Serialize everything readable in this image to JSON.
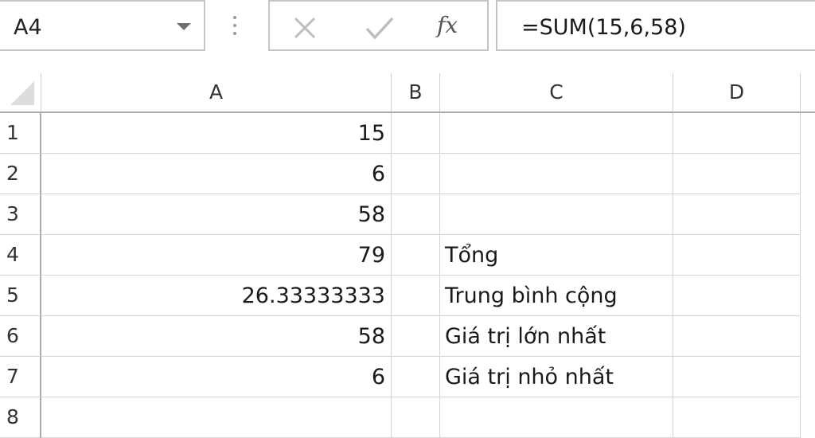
{
  "name_box": {
    "value": "A4"
  },
  "formula_bar": {
    "formula": "=SUM(15,6,58)",
    "fx_label": "fx"
  },
  "columns": [
    "A",
    "B",
    "C",
    "D"
  ],
  "rows": [
    {
      "number": "1",
      "A": "15",
      "C": ""
    },
    {
      "number": "2",
      "A": "6",
      "C": ""
    },
    {
      "number": "3",
      "A": "58",
      "C": ""
    },
    {
      "number": "4",
      "A": "79",
      "C": "Tổng"
    },
    {
      "number": "5",
      "A": "26.33333333",
      "C": "Trung bình cộng"
    },
    {
      "number": "6",
      "A": "58",
      "C": "Giá trị lớn nhất"
    },
    {
      "number": "7",
      "A": "6",
      "C": "Giá trị nhỏ nhất"
    },
    {
      "number": "8",
      "A": "",
      "C": ""
    }
  ]
}
